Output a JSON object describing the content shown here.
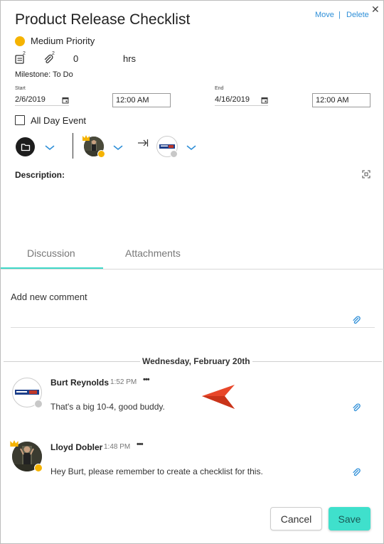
{
  "header": {
    "title": "Product Release Checklist",
    "move_label": "Move",
    "separator": "|",
    "delete_label": "Delete",
    "close_glyph": "✕"
  },
  "priority": {
    "label": "Medium Priority",
    "color": "#f5b301"
  },
  "metrics": {
    "list_count": "2",
    "attach_count": "2",
    "hours_value": "0",
    "hours_unit": "hrs"
  },
  "milestone": "Milestone: To Do",
  "dates": {
    "start_label": "Start",
    "start_date": "2/6/2019",
    "start_time": "12:00 AM",
    "end_label": "End",
    "end_date": "4/16/2019",
    "end_time": "12:00 AM"
  },
  "all_day": {
    "label": "All Day Event",
    "checked": false
  },
  "description": {
    "label": "Description:"
  },
  "tabs": [
    {
      "label": "Discussion",
      "active": true
    },
    {
      "label": "Attachments",
      "active": false
    }
  ],
  "new_comment": {
    "placeholder": "Add new comment"
  },
  "date_divider": "Wednesday, February 20th",
  "comments": [
    {
      "author": "Burt Reynolds",
      "time": "1:52 PM",
      "more": "•••",
      "text": "That's a big 10-4, good buddy."
    },
    {
      "author": "Lloyd Dobler",
      "time": "1:48 PM",
      "more": "•••",
      "text": "Hey Burt, please remember to create a checklist for this."
    }
  ],
  "actions": {
    "cancel_label": "Cancel",
    "save_label": "Save"
  },
  "colors": {
    "accent": "#3fe0cc",
    "link": "#2e8fd8",
    "cursor": "#e8472a",
    "status_away": "#f5b301",
    "status_offline": "#c8c8c8"
  }
}
